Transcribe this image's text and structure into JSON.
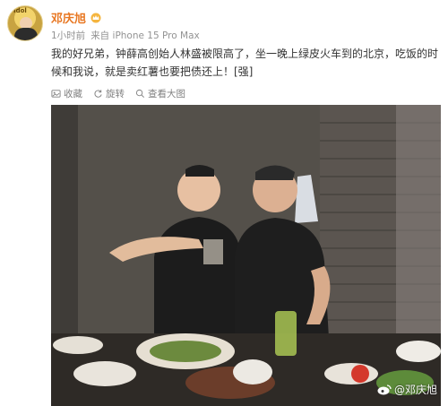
{
  "user": {
    "name": "邓庆旭",
    "avatar_badge": "Idol"
  },
  "meta": {
    "time": "1小时前",
    "source_prefix": "来自",
    "device": "iPhone 15 Pro Max"
  },
  "post": {
    "text": "我的好兄弟，钟薛高创始人林盛被限高了，坐一晚上绿皮火车到的北京，吃饭的时候和我说，就是卖红薯也要把债还上！[强]"
  },
  "actions": {
    "collect": "收藏",
    "rotate": "旋转",
    "view_large": "查看大图"
  },
  "photo": {
    "watermark": "@邓庆旭"
  },
  "colors": {
    "username": "#e87722",
    "meta": "#939393",
    "text": "#333333"
  }
}
